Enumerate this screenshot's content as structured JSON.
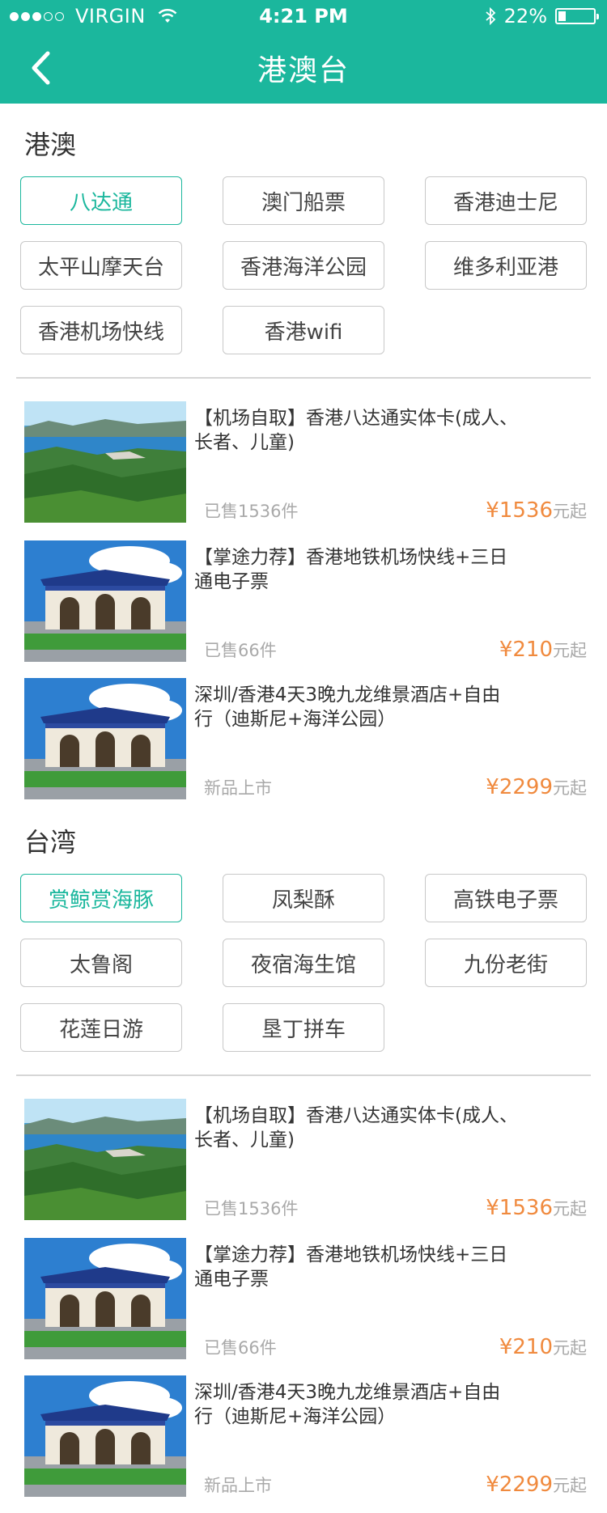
{
  "status_bar": {
    "carrier": "VIRGIN",
    "time": "4:21 PM",
    "battery": "22%",
    "battery_level": 0.22
  },
  "header": {
    "title": "港澳台"
  },
  "sections": [
    {
      "title": "港澳",
      "tags": [
        {
          "label": "八达通",
          "active": true
        },
        {
          "label": "澳门船票",
          "active": false
        },
        {
          "label": "香港迪士尼",
          "active": false
        },
        {
          "label": "太平山摩天台",
          "active": false
        },
        {
          "label": "香港海洋公园",
          "active": false
        },
        {
          "label": "维多利亚港",
          "active": false
        },
        {
          "label": "香港机场快线",
          "active": false
        },
        {
          "label": "香港wifi",
          "active": false
        }
      ],
      "products": [
        {
          "image": "coastline-landscape",
          "title": "【机场自取】香港八达通实体卡(成人、长者、儿童)",
          "sold": "已售1536件",
          "currency": "¥",
          "price": "1536",
          "suffix": "元起"
        },
        {
          "image": "memorial-gate",
          "title": "【掌途力荐】香港地铁机场快线+三日通电子票",
          "sold": "已售66件",
          "currency": "¥",
          "price": "210",
          "suffix": "元起"
        },
        {
          "image": "memorial-gate",
          "title": "深圳/香港4天3晚九龙维景酒店+自由行（迪斯尼+海洋公园）",
          "sold": "新品上市",
          "currency": "¥",
          "price": "2299",
          "suffix": "元起"
        }
      ]
    },
    {
      "title": "台湾",
      "tags": [
        {
          "label": "赏鲸赏海豚",
          "active": true
        },
        {
          "label": "凤梨酥",
          "active": false
        },
        {
          "label": "高铁电子票",
          "active": false
        },
        {
          "label": "太鲁阁",
          "active": false
        },
        {
          "label": "夜宿海生馆",
          "active": false
        },
        {
          "label": "九份老街",
          "active": false
        },
        {
          "label": "花莲日游",
          "active": false
        },
        {
          "label": "垦丁拼车",
          "active": false
        }
      ],
      "products": [
        {
          "image": "coastline-landscape",
          "title": "【机场自取】香港八达通实体卡(成人、长者、儿童)",
          "sold": "已售1536件",
          "currency": "¥",
          "price": "1536",
          "suffix": "元起"
        },
        {
          "image": "memorial-gate",
          "title": "【掌途力荐】香港地铁机场快线+三日通电子票",
          "sold": "已售66件",
          "currency": "¥",
          "price": "210",
          "suffix": "元起"
        },
        {
          "image": "memorial-gate",
          "title": "深圳/香港4天3晚九龙维景酒店+自由行（迪斯尼+海洋公园）",
          "sold": "新品上市",
          "currency": "¥",
          "price": "2299",
          "suffix": "元起"
        }
      ]
    }
  ],
  "colors": {
    "accent": "#1bb79d",
    "price": "#f08a3e",
    "muted": "#a9a9a9",
    "tag_border": "#c8c8c8"
  }
}
